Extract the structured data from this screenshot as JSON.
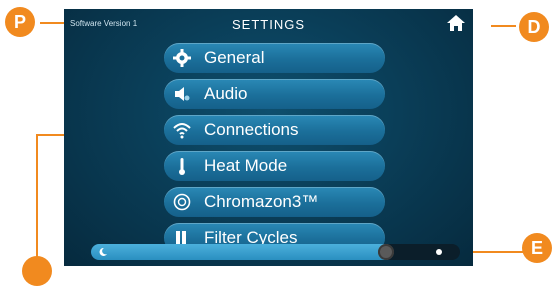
{
  "header": {
    "software_version": "Software Version 1",
    "title": "SETTINGS"
  },
  "menu": {
    "items": [
      {
        "label": "General",
        "icon": "gear-icon"
      },
      {
        "label": "Audio",
        "icon": "speaker-icon"
      },
      {
        "label": "Connections",
        "icon": "wifi-icon"
      },
      {
        "label": "Heat Mode",
        "icon": "thermometer-icon"
      },
      {
        "label": "Chromazon3™",
        "icon": "color-wheel-icon"
      },
      {
        "label": "Filter Cycles",
        "icon": "filter-icon"
      }
    ]
  },
  "brightness": {
    "level_fraction": 0.8
  },
  "callouts": {
    "p": "P",
    "d": "D",
    "e": "E"
  },
  "colors": {
    "accent": "#f18a1f",
    "button": "#1b6f9a",
    "screen_bg": "#0a3e58"
  }
}
